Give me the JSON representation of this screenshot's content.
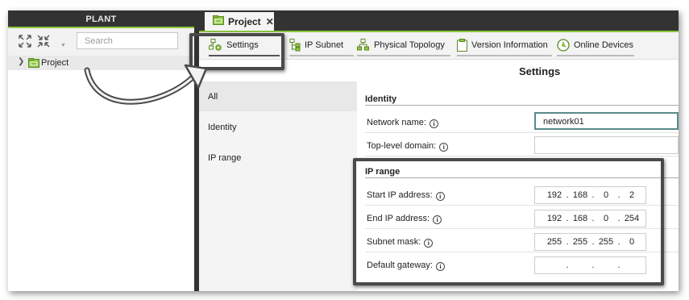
{
  "left_panel": {
    "title": "PLANT",
    "search_placeholder": "Search",
    "tree": [
      {
        "label": "Project",
        "expand": "❯"
      }
    ]
  },
  "tabbar": {
    "tab": {
      "label": "Project",
      "close": "✕"
    }
  },
  "toolbar": {
    "items": [
      {
        "label": "Settings",
        "icon": "settings-network-icon",
        "active": true
      },
      {
        "label": "IP Subnet",
        "icon": "subnet-icon"
      },
      {
        "label": "Physical Topology",
        "icon": "topology-icon"
      },
      {
        "label": "Version Information",
        "icon": "clipboard-icon"
      },
      {
        "label": "Online Devices",
        "icon": "online-devices-icon"
      }
    ]
  },
  "settings": {
    "title": "Settings",
    "nav": [
      {
        "label": "All",
        "active": true
      },
      {
        "label": "Identity"
      },
      {
        "label": "IP range"
      }
    ],
    "identity": {
      "section": "Identity",
      "network_name_label": "Network name:",
      "network_name_value": "network01",
      "tld_label": "Top-level domain:",
      "tld_value": ""
    },
    "ip_range": {
      "section": "IP range",
      "start_label": "Start IP address:",
      "start": [
        "192",
        "168",
        "0",
        "2"
      ],
      "end_label": "End IP address:",
      "end": [
        "192",
        "168",
        "0",
        "254"
      ],
      "mask_label": "Subnet mask:",
      "mask": [
        "255",
        "255",
        "255",
        "0"
      ],
      "gateway_label": "Default gateway:",
      "gateway": [
        "",
        "",
        "",
        ""
      ]
    }
  },
  "colors": {
    "dark_bar": "#333333",
    "accent_green": "#8dc63f",
    "highlight_border": "#4a4a4a"
  }
}
